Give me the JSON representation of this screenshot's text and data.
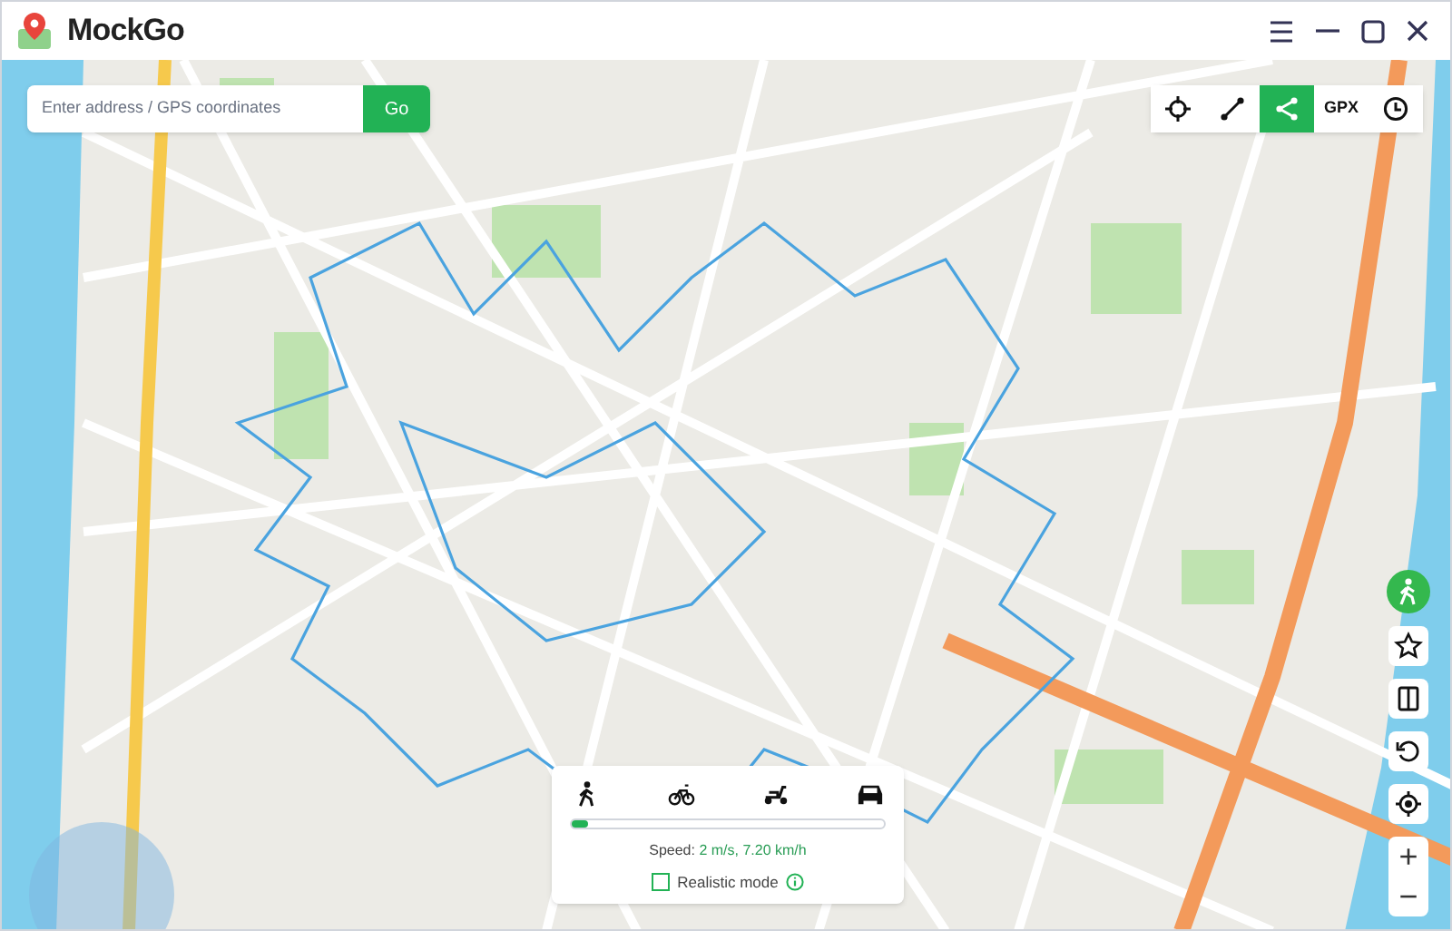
{
  "app": {
    "title": "MockGo"
  },
  "search": {
    "placeholder": "Enter address / GPS coordinates",
    "button": "Go"
  },
  "toolbar": [
    {
      "selected": false
    },
    {
      "selected": false
    },
    {
      "selected": true
    },
    {
      "label": "GPX",
      "selected": false
    },
    {
      "selected": false
    }
  ],
  "side_buttons": [
    {
      "selected": true
    },
    {
      "selected": false
    },
    {
      "selected": false
    },
    {
      "selected": false
    },
    {
      "selected": false
    }
  ],
  "zoom": {
    "plus": "+",
    "minus": "−"
  },
  "speed_panel": {
    "level": 0.05,
    "speed_label": "Speed:",
    "speed_value": "2 m/s, 7.20 km/h",
    "realistic_mode": {
      "label": "Realistic mode",
      "checked": false
    }
  }
}
